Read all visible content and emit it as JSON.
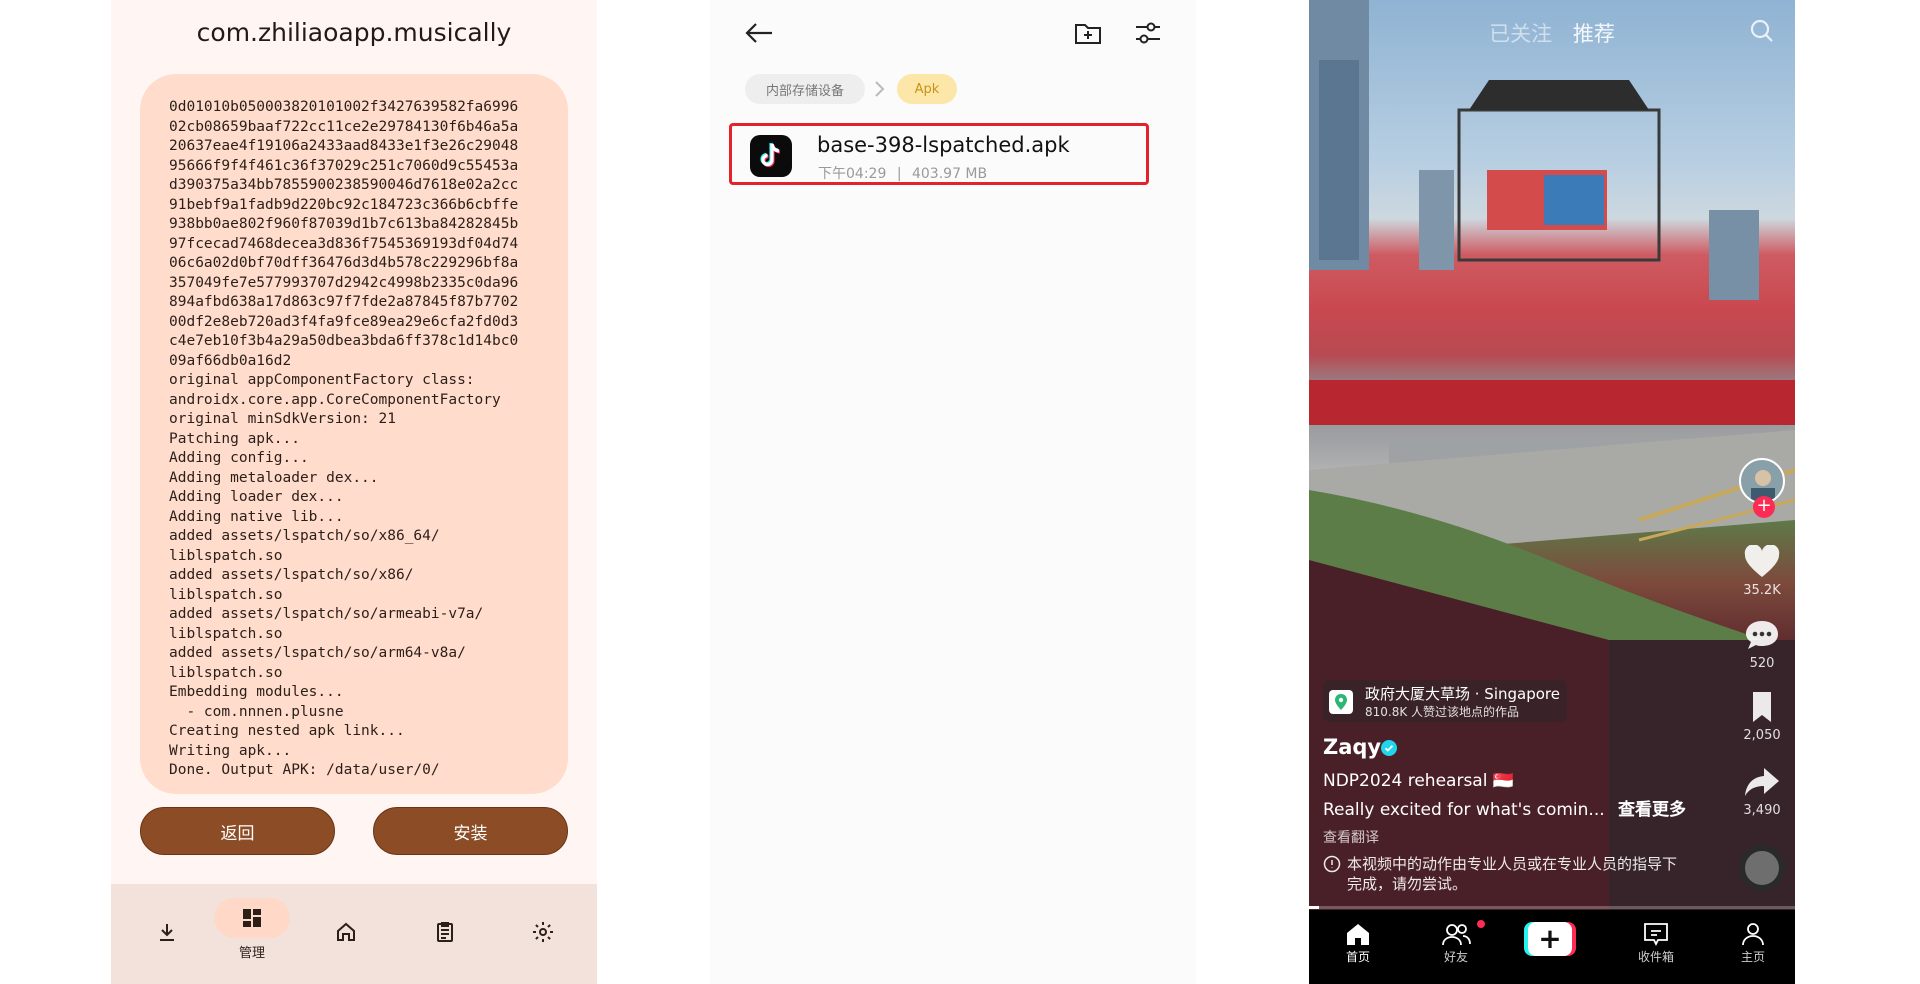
{
  "lspatch": {
    "package_name": "com.zhiliaoapp.musically",
    "log_lines": [
      "0d01010b050003820101002f3427639582fa6996",
      "02cb08659baaf722cc11ce2e29784130f6b46a5a",
      "20637eae4f19106a2433aad8433e1f3e26c29048",
      "95666f9f4f461c36f37029c251c7060d9c55453a",
      "d390375a34bb7855900238590046d7618e02a2cc",
      "91bebf9a1fadb9d220bc92c184723c366b6cbffe",
      "938bb0ae802f960f87039d1b7c613ba84282845b",
      "97fcecad7468decea3d836f7545369193df04d74",
      "06c6a02d0bf70dff36476d3d4b578c229296bf8a",
      "357049fe7e577993707d2942c4998b2335c0da96",
      "894afbd638a17d863c97f7fde2a87845f87b7702",
      "00df2e8eb720ad3f4fa9fce89ea29e6cfa2fd0d3",
      "c4e7eb10f3b4a29a50dbea3bda6ff378c1d14bc0",
      "09af66db0a16d2",
      "original appComponentFactory class:",
      "androidx.core.app.CoreComponentFactory",
      "original minSdkVersion: 21",
      "Patching apk...",
      "Adding config...",
      "Adding metaloader dex...",
      "Adding loader dex...",
      "Adding native lib...",
      "added assets/lspatch/so/x86_64/",
      "liblspatch.so",
      "added assets/lspatch/so/x86/",
      "liblspatch.so",
      "added assets/lspatch/so/armeabi-v7a/",
      "liblspatch.so",
      "added assets/lspatch/so/arm64-v8a/",
      "liblspatch.so",
      "Embedding modules...",
      "  - com.nnnen.plusne",
      "Creating nested apk link...",
      "Writing apk...",
      "Done. Output APK: /data/user/0/"
    ],
    "back_label": "返回",
    "install_label": "安装",
    "nav": {
      "manage_label": "管理",
      "icons": [
        "download-icon",
        "manage-icon",
        "home-icon",
        "logs-icon",
        "settings-icon"
      ]
    },
    "colors": {
      "accent": "#8b4c26",
      "log_bg": "#ffdccb",
      "nav_bg": "#f3e2dc"
    }
  },
  "file_manager": {
    "breadcrumbs": [
      "内部存储设备",
      "Apk"
    ],
    "file": {
      "name": "base-398-lspatched.apk",
      "time": "下午04:29",
      "separator": "|",
      "size": "403.97 MB"
    },
    "icons": [
      "back-arrow-icon",
      "new-folder-icon",
      "filter-icon"
    ],
    "colors": {
      "highlight": "#e3232c",
      "crumb_active": "#c8921a"
    }
  },
  "tiktok": {
    "tabs": {
      "following": "已关注",
      "recommended": "推荐"
    },
    "location": {
      "name": "政府大厦大草场 · Singapore",
      "subtitle": "810.8K 人赞过该地点的作品"
    },
    "author": "Zaqy",
    "caption_line1": "NDP2024 rehearsal 🇸🇬",
    "caption_line2": "Really excited for what's comin...",
    "see_more": "查看更多",
    "translate": "查看翻译",
    "warning": "本视频中的动作由专业人员或在专业人员的指导下完成，请勿尝试。",
    "actions": {
      "likes": "35.2K",
      "comments": "520",
      "favorites": "2,050",
      "shares": "3,490"
    },
    "progress": 0.02,
    "bottom_nav": {
      "home": "首页",
      "friends": "好友",
      "inbox": "收件箱",
      "profile": "主页"
    },
    "colors": {
      "brand_red": "#fe2c55",
      "brand_cyan": "#25f4ee"
    }
  }
}
